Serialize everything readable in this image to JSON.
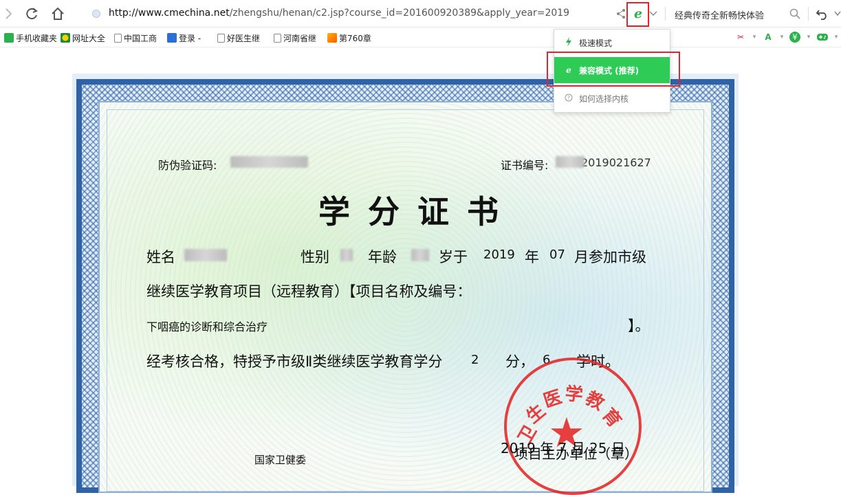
{
  "toolbar": {
    "url_host": "http://www.cmechina.net",
    "url_rest": "/zhengshu/henan/c2.jsp?course_id=201600920389&apply_year=2019",
    "search_text": "经典传奇全新畅快体验",
    "engine_icon": "e"
  },
  "bookmarks": [
    {
      "label": "手机收藏夹",
      "icon": "phone-icon"
    },
    {
      "label": "网址大全",
      "icon": "globe-icon"
    },
    {
      "label": "中国工商",
      "icon": "page-icon"
    },
    {
      "label": "登录 -",
      "icon": "baidu-icon"
    },
    {
      "label": "好医生继",
      "icon": "page-icon"
    },
    {
      "label": "河南省继",
      "icon": "page-icon"
    },
    {
      "label": "第760章",
      "icon": "fire-icon"
    }
  ],
  "menu": {
    "items": [
      {
        "label": "极速模式",
        "icon": "lightning-icon"
      },
      {
        "label": "兼容模式 (推荐)",
        "icon": "ie-icon"
      },
      {
        "label": "如何选择内核",
        "icon": "help-icon"
      }
    ]
  },
  "certificate": {
    "anti_fake_label": "防伪验证码:",
    "cert_no_label": "证书编号:",
    "cert_no_visible": "2019021627",
    "title": "学分证书",
    "name_label": "姓名",
    "gender_label": "性别",
    "age_label": "年龄",
    "year_label": "岁于",
    "year": "2019",
    "year_unit": "年",
    "month": "07",
    "month_text": "月参加市级",
    "line2": "继续医学教育项目（远程教育）【项目名称及编号：",
    "project_name": "下咽癌的诊断和综合治疗",
    "line3_end": "】。",
    "line4_a": "经考核合格，特授予市级Ⅱ类继续医学教育学分",
    "credits": "2",
    "line4_b": "分，",
    "hours": "6",
    "line4_c": "学时。",
    "date_text": "2019 年 7 月 25 日",
    "issuer_text": "项目主办单位（章）",
    "bottom_left_text": "国家卫健委",
    "seal_text_1": "卫",
    "seal_text_2": "生",
    "seal_text_3": "医",
    "seal_text_4": "学",
    "seal_text_5": "教",
    "seal_text_6": "育"
  }
}
